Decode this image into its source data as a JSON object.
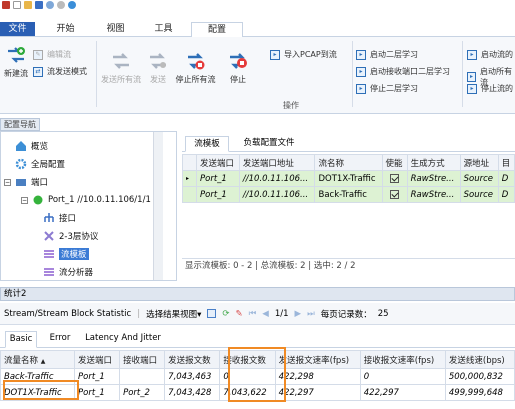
{
  "ribbon_tabs": {
    "file": "文件",
    "start": "开始",
    "view": "视图",
    "tools": "工具",
    "config": "配置"
  },
  "ribbon": {
    "new_stream": "新建流",
    "edit_stream": "编辑流",
    "send_mode": "流发送模式",
    "send_all": "发送所有流",
    "send": "发送",
    "stop_all": "停止所有流",
    "stop": "停止",
    "import_pcap": "导入PCAP到流",
    "group_label": "操作",
    "l2_start": "启动二层学习",
    "l2_start_rx": "启动接收端口二层学习",
    "l2_stop": "停止二层学习",
    "c_start": "启动流的",
    "c_start_all": "启动所有流",
    "c_stop": "停止流的"
  },
  "nav": {
    "header": "配置导航",
    "items": [
      {
        "label": "概览"
      },
      {
        "label": "全局配置"
      },
      {
        "label": "端口"
      },
      {
        "label": "Port_1 //10.0.11.106/1/1"
      },
      {
        "label": "接口"
      },
      {
        "label": "2-3层协议"
      },
      {
        "label": "流模板"
      },
      {
        "label": "流分析器"
      }
    ]
  },
  "stream_tabs": {
    "template": "流模板",
    "load": "负载配置文件"
  },
  "stream_table": {
    "headers": [
      "发送端口",
      "发送端口地址",
      "流名称",
      "使能",
      "生成方式",
      "源地址",
      "目"
    ],
    "rows": [
      {
        "port": "Port_1",
        "addr": "//10.0.11.106...",
        "name": "DOT1X-Traffic",
        "gen": "RawStre...",
        "src": "Source",
        "dst": "D"
      },
      {
        "port": "Port_1",
        "addr": "//10.0.11.106...",
        "name": "Back-Traffic",
        "gen": "RawStre...",
        "src": "Source",
        "dst": "D"
      }
    ],
    "status": "显示流模板: 0 - 2 | 总流模板: 2 | 选中: 2 / 2"
  },
  "stats": {
    "header": "统计2",
    "toolbar": {
      "title": "Stream/Stream Block Statistic",
      "view": "选择结果视图",
      "page": "1/1",
      "per_page_label": "每页记录数：",
      "per_page": "25"
    },
    "tabs": [
      "Basic",
      "Error",
      "Latency And Jitter"
    ],
    "headers": [
      "流量名称",
      "发送端口",
      "接收端口",
      "发送报文数",
      "接收报文数",
      "发送报文速率(fps)",
      "接收报文速率(fps)",
      "发送线速(bps)"
    ],
    "rows": [
      [
        "Back-Traffic",
        "Port_1",
        "",
        "7,043,463",
        "0",
        "422,298",
        "0",
        "500,000,832"
      ],
      [
        "DOT1X-Traffic",
        "Port_1",
        "Port_2",
        "7,043,428",
        "7,043,622",
        "422,297",
        "422,297",
        "499,999,648"
      ]
    ]
  },
  "colors": {
    "accent": "#2a5fb4",
    "highlight": "#f08a24",
    "selected_row": "#ddf2d3"
  }
}
